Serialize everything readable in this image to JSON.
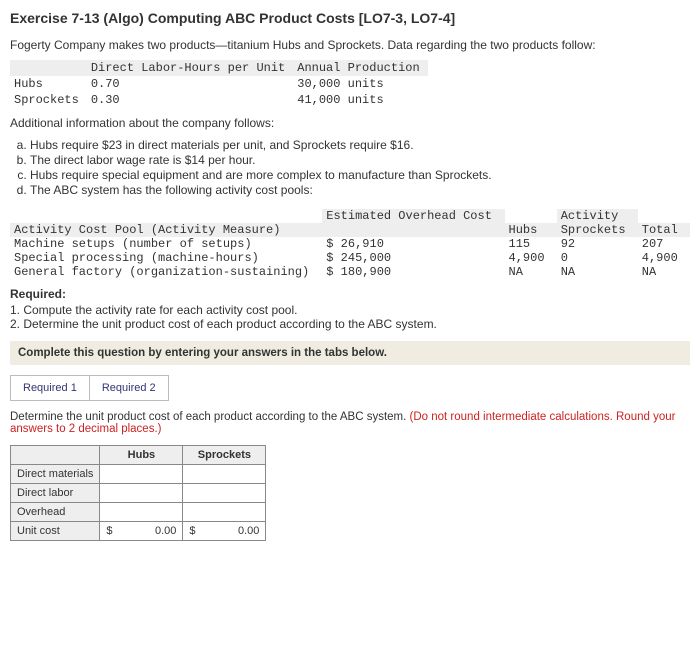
{
  "title": "Exercise 7-13 (Algo) Computing ABC Product Costs [LO7-3, LO7-4]",
  "intro": "Fogerty Company makes two products—titanium Hubs and Sprockets. Data regarding the two products follow:",
  "prod_table": {
    "h2": "Direct Labor-Hours per Unit",
    "h3": "Annual Production",
    "rows": [
      {
        "name": "Hubs",
        "dlh": "0.70",
        "prod": "30,000 units"
      },
      {
        "name": "Sprockets",
        "dlh": "0.30",
        "prod": "41,000 units"
      }
    ]
  },
  "addl_heading": "Additional information about the company follows:",
  "notes": [
    "Hubs require $23 in direct materials per unit, and Sprockets require $16.",
    "The direct labor wage rate is $14 per hour.",
    "Hubs require special equipment and are more complex to manufacture than Sprockets.",
    "The ABC system has the following activity cost pools:"
  ],
  "activity_table": {
    "col1": "Activity Cost Pool (Activity Measure)",
    "col2": "Estimated Overhead Cost",
    "act_header": "Activity",
    "col3": "Hubs",
    "col4": "Sprockets",
    "col5": "Total",
    "rows": [
      {
        "name": "Machine setups (number of setups)",
        "cost": "$ 26,910",
        "hubs": "115",
        "spr": "92",
        "tot": "207"
      },
      {
        "name": "Special processing (machine-hours)",
        "cost": "$ 245,000",
        "hubs": "4,900",
        "spr": "0",
        "tot": "4,900"
      },
      {
        "name": "General factory (organization-sustaining)",
        "cost": "$ 180,900",
        "hubs": "NA",
        "spr": "NA",
        "tot": "NA"
      }
    ]
  },
  "required_h": "Required:",
  "required": [
    "Compute the activity rate for each activity cost pool.",
    "Determine the unit product cost of each product according to the ABC system."
  ],
  "complete_msg": "Complete this question by entering your answers in the tabs below.",
  "tabs": {
    "t1": "Required 1",
    "t2": "Required 2"
  },
  "instr_black": "Determine the unit product cost of each product according to the ABC system. ",
  "instr_red": "(Do not round intermediate calculations. Round your answers to 2 decimal places.)",
  "answer": {
    "h_hubs": "Hubs",
    "h_spr": "Sprockets",
    "rows": [
      "Direct materials",
      "Direct labor",
      "Overhead",
      "Unit cost"
    ],
    "cur": "$",
    "zero": "0.00"
  }
}
